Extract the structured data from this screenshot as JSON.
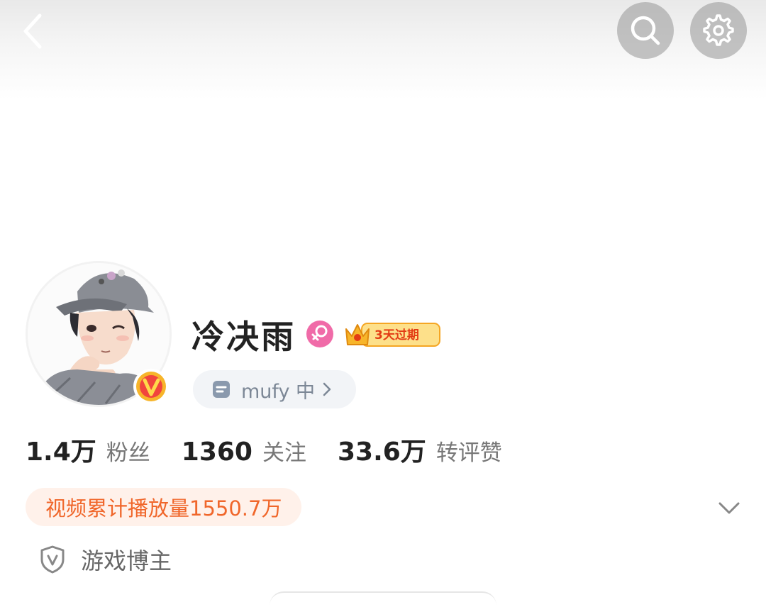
{
  "header": {
    "back_icon": "chevron-left-icon",
    "search_icon": "search-icon",
    "settings_icon": "gear-icon"
  },
  "profile": {
    "name": "冷决雨",
    "gender_icon": "female-icon",
    "gender_color": "#f06ba8",
    "vip_badge_text": "3天过期",
    "verified_badge": "v-badge-icon",
    "tag_text": "mufy 中",
    "tag_icon": "note-icon"
  },
  "stats": [
    {
      "number": "1.4万",
      "label": "粉丝"
    },
    {
      "number": "1360",
      "label": "关注"
    },
    {
      "number": "33.6万",
      "label": "转评赞"
    }
  ],
  "video_play_text": "视频累计播放量1550.7万",
  "category_text": "游戏博主",
  "colors": {
    "accent_orange": "#f0662a",
    "play_pill_bg": "#fff1ea",
    "tag_bg": "#f2f4f7",
    "vip_gold": "#f7b52a"
  }
}
